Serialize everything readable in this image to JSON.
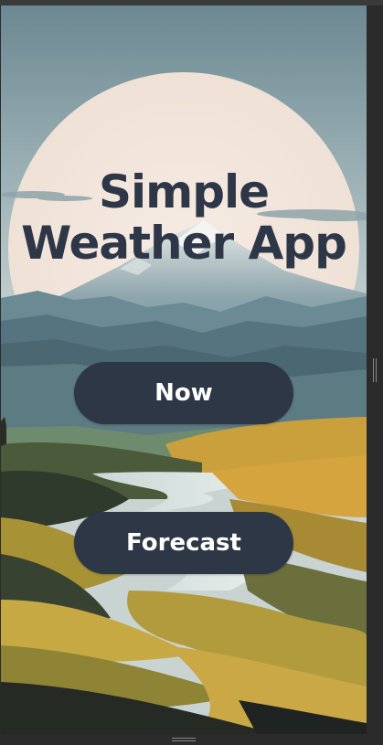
{
  "app": {
    "title_line1": "Simple",
    "title_line2": "Weather App"
  },
  "buttons": {
    "now_label": "Now",
    "forecast_label": "Forecast"
  },
  "colors": {
    "title_text": "#2d3748",
    "button_bg": "#2e3746",
    "button_text": "#ffffff",
    "sky": "#6f8d97",
    "sun": "#f3e6dc"
  }
}
